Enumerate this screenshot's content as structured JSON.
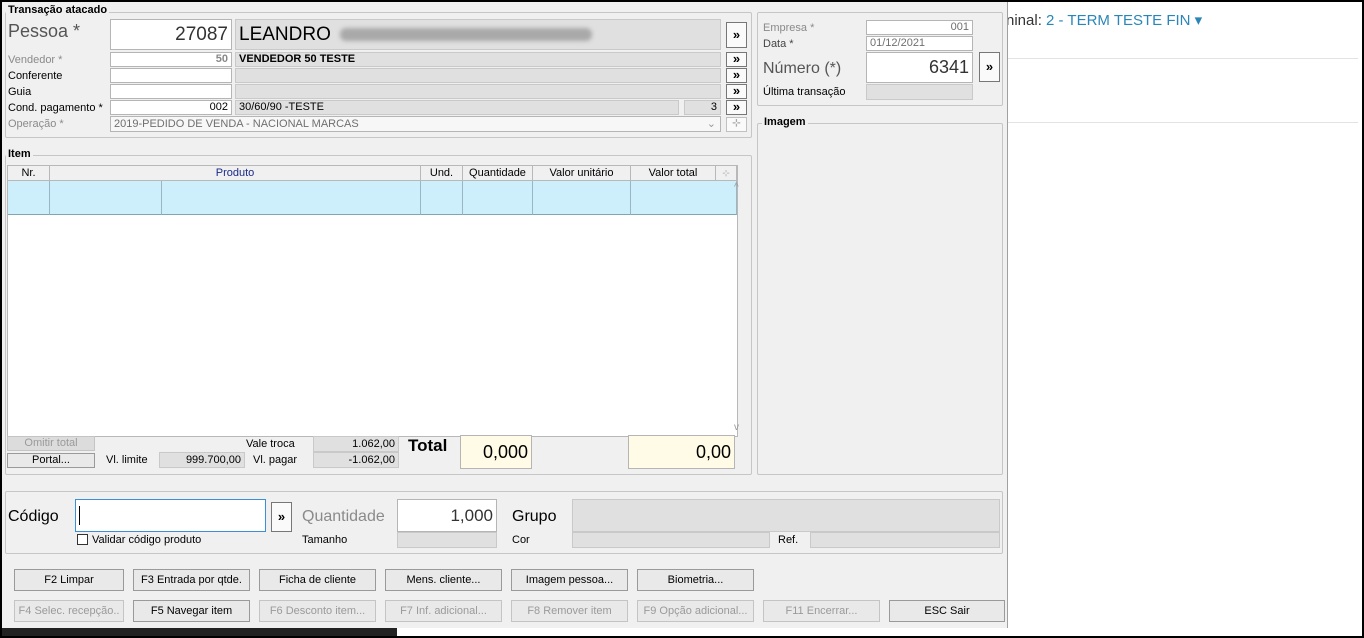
{
  "background_page": {
    "terminal_prefix": "ninal: ",
    "terminal_link": "2 - TERM TESTE FIN",
    "terminal_caret": "▾"
  },
  "transacao": {
    "title": "Transação atacado",
    "pessoa_label": "Pessoa *",
    "pessoa_code": "27087",
    "pessoa_name": "LEANDRO",
    "vendedor_label": "Vendedor *",
    "vendedor_code": "50",
    "vendedor_name": "VENDEDOR 50 TESTE",
    "conferente_label": "Conferente",
    "guia_label": "Guia",
    "cond_label": "Cond. pagamento *",
    "cond_code": "002",
    "cond_name": "30/60/90 -TESTE",
    "cond_count": "3",
    "operacao_label": "Operação *",
    "operacao_value": "2019-PEDIDO DE VENDA - NACIONAL MARCAS",
    "more_glyph": "»"
  },
  "header_right": {
    "empresa_label": "Empresa *",
    "empresa_value": "001",
    "data_label": "Data *",
    "data_value": "01/12/2021",
    "numero_label": "Número (*)",
    "numero_value": "6341",
    "ultima_label": "Última transação",
    "imagem_title": "Imagem"
  },
  "item": {
    "title": "Item",
    "columns": [
      "Nr.",
      "Produto",
      "Und.",
      "Quantidade",
      "Valor unitário",
      "Valor total"
    ]
  },
  "totals": {
    "omitir_total": "Omitir total",
    "portal": "Portal...",
    "vl_limite_label": "Vl. limite",
    "vl_limite_value": "999.700,00",
    "vale_troca_label": "Vale troca",
    "vale_troca_value": "1.062,00",
    "vl_pagar_label": "Vl. pagar",
    "vl_pagar_value": "-1.062,00",
    "total_label": "Total",
    "total_qty": "0,000",
    "total_value": "0,00"
  },
  "entry": {
    "codigo_label": "Código",
    "validar_label": "Validar código produto",
    "quantidade_label": "Quantidade",
    "quantidade_value": "1,000",
    "tamanho_label": "Tamanho",
    "grupo_label": "Grupo",
    "cor_label": "Cor",
    "ref_label": "Ref."
  },
  "buttons_row1": [
    "F2 Limpar",
    "F3 Entrada por qtde.",
    "Ficha de cliente",
    "Mens. cliente...",
    "Imagem pessoa...",
    "Biometria..."
  ],
  "buttons_row2": [
    "F4 Selec. recepção..",
    "F5 Navegar item",
    "F6 Desconto item...",
    "F7 Inf. adicional...",
    "F8 Remover item",
    "F9 Opção adicional...",
    "F11 Encerrar...",
    "ESC Sair"
  ]
}
